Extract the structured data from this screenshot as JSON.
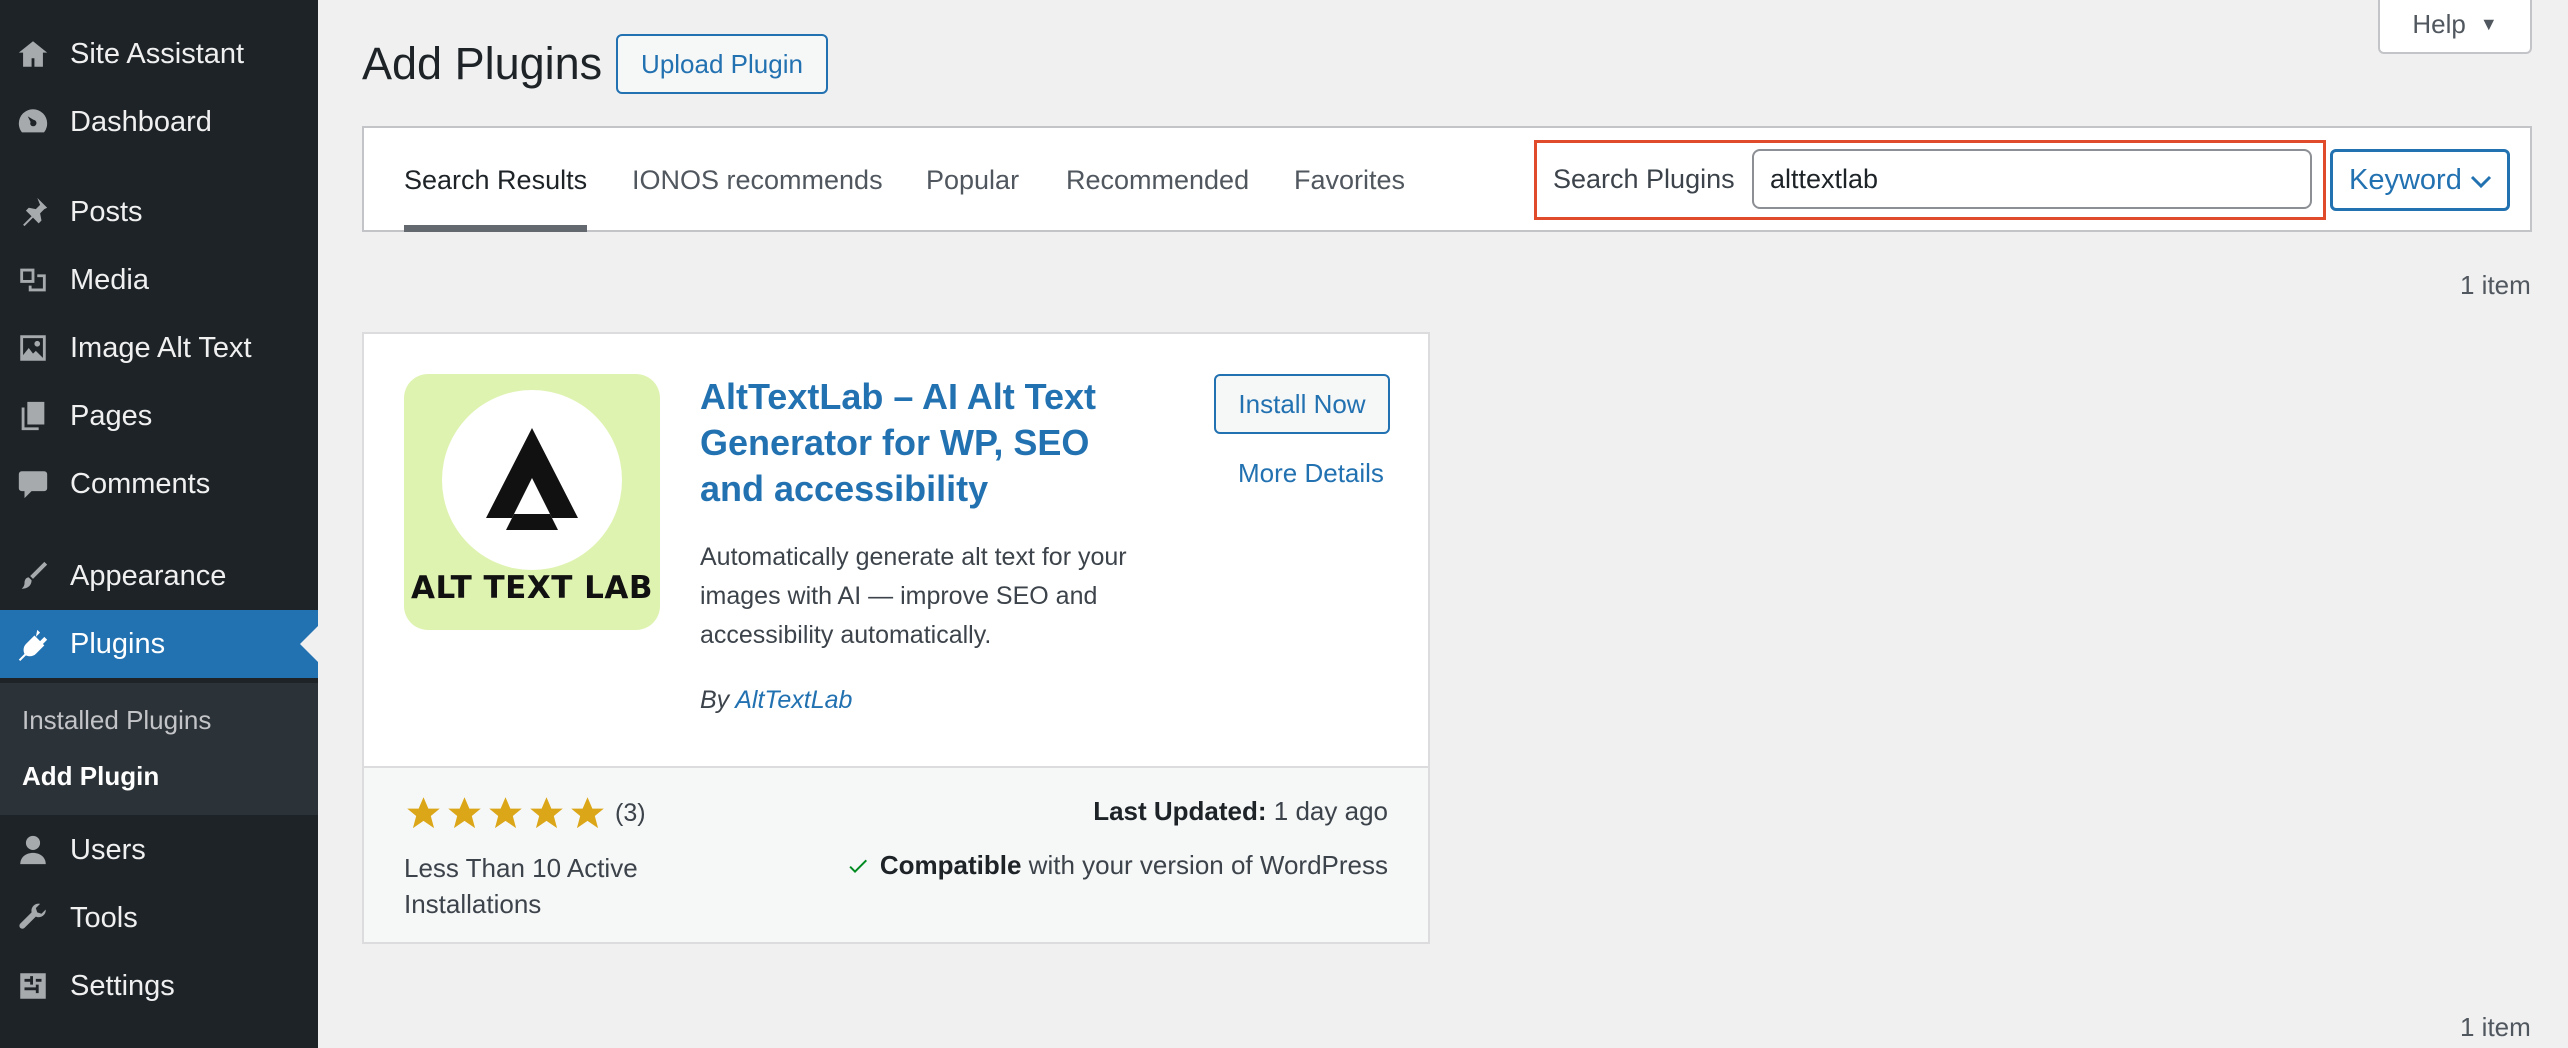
{
  "sidebar": {
    "items": [
      {
        "label": "Site Assistant",
        "icon": "home-icon"
      },
      {
        "label": "Dashboard",
        "icon": "dashboard-icon"
      },
      {
        "label": "Posts",
        "icon": "pin-icon"
      },
      {
        "label": "Media",
        "icon": "media-icon"
      },
      {
        "label": "Image Alt Text",
        "icon": "image-icon"
      },
      {
        "label": "Pages",
        "icon": "pages-icon"
      },
      {
        "label": "Comments",
        "icon": "comment-icon"
      },
      {
        "label": "Appearance",
        "icon": "brush-icon"
      },
      {
        "label": "Plugins",
        "icon": "plugin-icon"
      },
      {
        "label": "Users",
        "icon": "user-icon"
      },
      {
        "label": "Tools",
        "icon": "wrench-icon"
      },
      {
        "label": "Settings",
        "icon": "settings-icon"
      }
    ],
    "active_item": "Plugins",
    "submenu": [
      {
        "label": "Installed Plugins"
      },
      {
        "label": "Add Plugin"
      }
    ],
    "current_submenu": "Add Plugin"
  },
  "header": {
    "help_label": "Help",
    "title": "Add Plugins",
    "upload_label": "Upload Plugin"
  },
  "filter": {
    "tabs": [
      {
        "label": "Search Results"
      },
      {
        "label": "IONOS recommends"
      },
      {
        "label": "Popular"
      },
      {
        "label": "Recommended"
      },
      {
        "label": "Favorites"
      }
    ],
    "current_tab": "Search Results",
    "search_label": "Search Plugins",
    "search_value": "alttextlab",
    "search_type": "Keyword"
  },
  "results_count_top": "1 item",
  "results_count_bottom": "1 item",
  "plugin": {
    "logo_text": "ALT TEXT LAB",
    "name": "AltTextLab – AI Alt Text Generator for WP, SEO and accessibility",
    "description": "Automatically generate alt text for your images with AI — improve SEO and accessibility automatically.",
    "author_prefix": "By",
    "author": "AltTextLab",
    "install_label": "Install Now",
    "more_details_label": "More Details",
    "rating": 5,
    "rating_count": "(3)",
    "active_installs": "Less Than 10 Active Installations",
    "last_updated_label": "Last Updated:",
    "last_updated_value": "1 day ago",
    "compatible_label": "Compatible",
    "compatible_text": "with your version of WordPress"
  },
  "colors": {
    "sidebar_bg": "#1d2327",
    "accent": "#2271b1",
    "highlight_border": "#e04b2c",
    "star": "#dba617",
    "check": "#008a20",
    "logo_bg": "#dff3b1"
  }
}
